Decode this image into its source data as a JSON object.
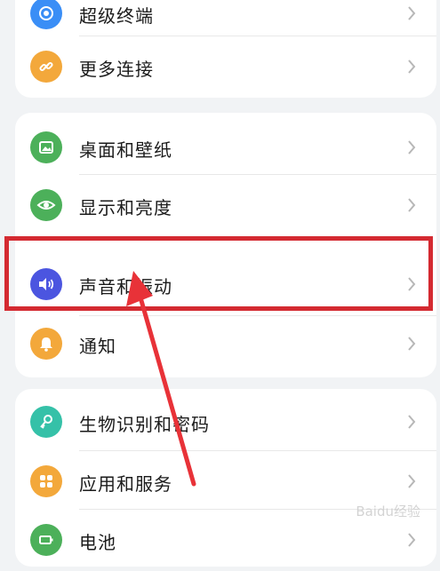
{
  "settings": {
    "group1": [
      {
        "label": "超级终端",
        "icon": "super-device-icon",
        "color": "#3a8ef6"
      },
      {
        "label": "更多连接",
        "icon": "link-icon",
        "color": "#f3a83b"
      }
    ],
    "group2": [
      {
        "label": "桌面和壁纸",
        "icon": "wallpaper-icon",
        "color": "#4cb05a"
      },
      {
        "label": "显示和亮度",
        "icon": "eye-icon",
        "color": "#4cb05a"
      },
      {
        "label": "声音和振动",
        "icon": "speaker-icon",
        "color": "#4b55e0"
      },
      {
        "label": "通知",
        "icon": "bell-icon",
        "color": "#f3a83b"
      }
    ],
    "group3": [
      {
        "label": "生物识别和密码",
        "icon": "key-icon",
        "color": "#35c1a8"
      },
      {
        "label": "应用和服务",
        "icon": "apps-icon",
        "color": "#f3a83b"
      },
      {
        "label": "电池",
        "icon": "battery-icon",
        "color": "#4cb05a"
      }
    ]
  },
  "annotation": {
    "highlight_color": "#d42a31",
    "highlighted_item": "声音和振动"
  },
  "watermark": {
    "text": "Baidu经验"
  }
}
